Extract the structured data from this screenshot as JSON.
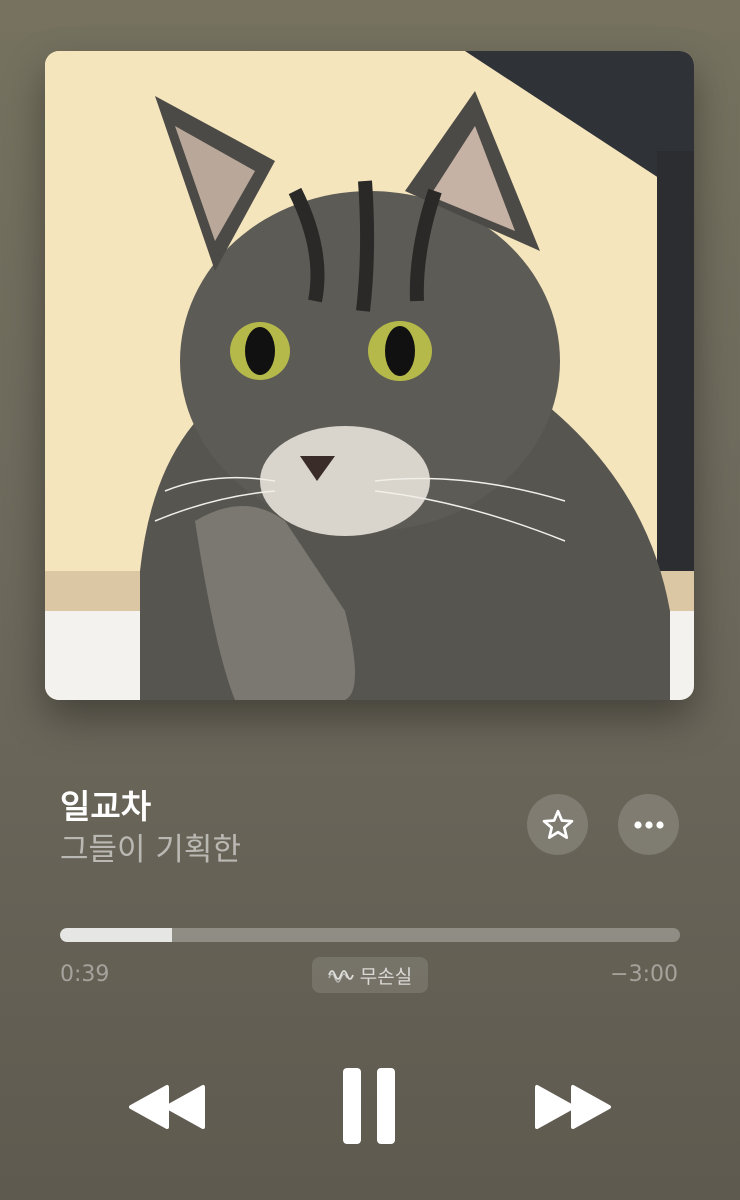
{
  "now_playing": {
    "title": "일교차",
    "artist": "그들이 기획한",
    "artwork": "tabby-cat-photo"
  },
  "actions": {
    "favorite_icon": "star-icon",
    "more_icon": "ellipsis-icon"
  },
  "playback": {
    "elapsed": "0:39",
    "remaining": "−3:00",
    "progress_fraction": 0.18,
    "quality_label": "무손실",
    "quality_icon": "lossless-wave-icon",
    "state": "playing"
  },
  "controls": {
    "rewind_icon": "rewind-icon",
    "pause_icon": "pause-icon",
    "forward_icon": "fast-forward-icon"
  },
  "colors": {
    "background": "#6f6b5d",
    "text_primary": "#ffffff",
    "text_secondary": "rgba(255,255,255,0.55)"
  }
}
